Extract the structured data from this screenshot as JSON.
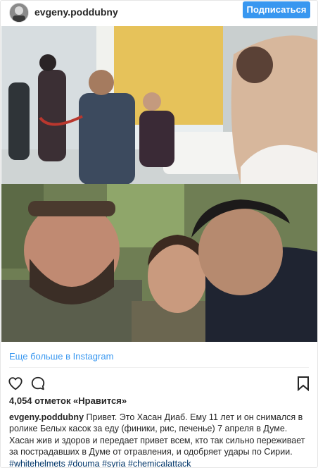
{
  "post": {
    "username": "evgeny.poddubny",
    "follow_label": "Подписаться",
    "more_link": "Еще больше в Instagram",
    "likes_text": "4,054 отметок «Нравится»",
    "caption_user": "evgeny.poddubny",
    "caption_text": "Привет. Это Хасан Диаб. Ему 11 лет и он снимался в ролике Белых касок за еду (финики, рис, печенье) 7 апреля в Думе. Хасан жив и здоров и передает привет всем, кто так сильно переживает за пострадавших в Думе от отравления, и одобряет удары по Сирии.",
    "hashtags": [
      "#whitehelmets",
      "#douma",
      "#syria",
      "#chemicalattack"
    ]
  },
  "icons": {
    "like": "heart-icon",
    "comment": "comment-icon",
    "save": "bookmark-icon"
  },
  "colors": {
    "accent": "#3897f0",
    "hashtag": "#003569",
    "text": "#262626"
  }
}
